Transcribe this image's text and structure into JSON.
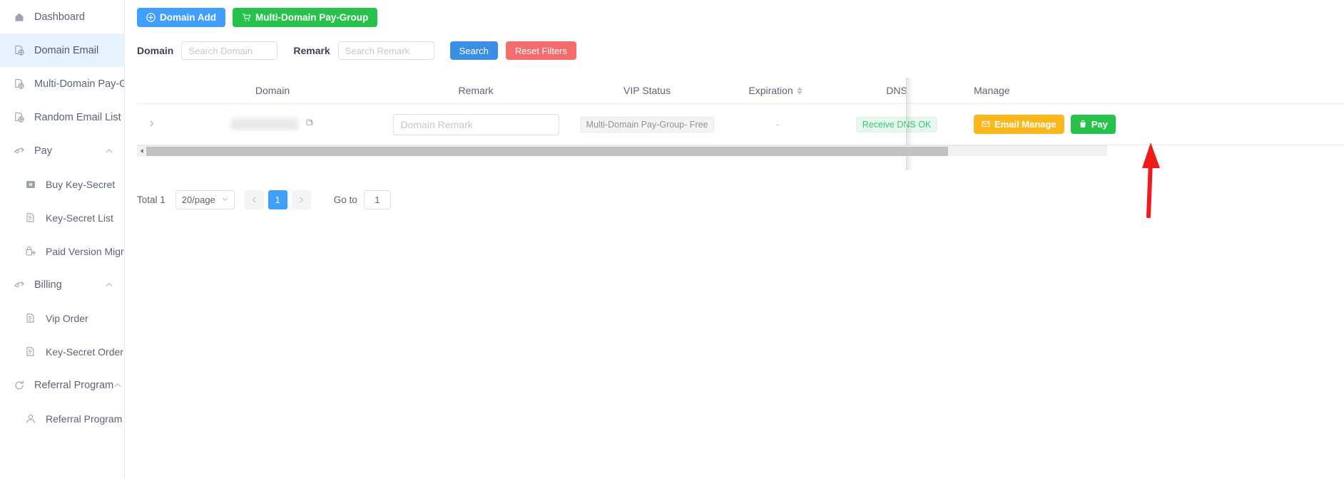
{
  "sidebar": {
    "items": [
      {
        "label": "Dashboard",
        "icon": "home-icon",
        "level": "top",
        "active": false,
        "expandable": false
      },
      {
        "label": "Domain Email",
        "icon": "globe-doc-icon",
        "level": "top",
        "active": true,
        "expandable": false
      },
      {
        "label": "Multi-Domain Pay-Group",
        "icon": "globe-doc-icon",
        "level": "top",
        "active": false,
        "expandable": false
      },
      {
        "label": "Random Email List",
        "icon": "globe-doc-icon",
        "level": "top",
        "active": false,
        "expandable": false
      },
      {
        "label": "Pay",
        "icon": "pay-icon",
        "level": "top",
        "active": false,
        "expandable": true
      },
      {
        "label": "Buy Key-Secret",
        "icon": "card-icon",
        "level": "child",
        "active": false,
        "expandable": false
      },
      {
        "label": "Key-Secret List",
        "icon": "list-doc-icon",
        "level": "child",
        "active": false,
        "expandable": false
      },
      {
        "label": "Paid Version Migration",
        "icon": "upgrade-icon",
        "level": "child",
        "active": false,
        "expandable": false
      },
      {
        "label": "Billing",
        "icon": "pay-icon",
        "level": "top",
        "active": false,
        "expandable": true
      },
      {
        "label": "Vip Order",
        "icon": "list-doc-icon",
        "level": "child",
        "active": false,
        "expandable": false
      },
      {
        "label": "Key-Secret Order",
        "icon": "list-doc-icon",
        "level": "child",
        "active": false,
        "expandable": false
      },
      {
        "label": "Referral Program",
        "icon": "refresh-icon",
        "level": "top",
        "active": false,
        "expandable": true
      },
      {
        "label": "Referral Program",
        "icon": "person-icon",
        "level": "child",
        "active": false,
        "expandable": false
      }
    ]
  },
  "toolbar": {
    "domain_add_label": "Domain Add",
    "domain_add_icon": "plus-circle-icon",
    "pay_group_label": "Multi-Domain Pay-Group",
    "pay_group_icon": "cart-icon"
  },
  "filters": {
    "domain_label": "Domain",
    "domain_placeholder": "Search Domain",
    "domain_value": "",
    "remark_label": "Remark",
    "remark_placeholder": "Search Remark",
    "remark_value": "",
    "search_label": "Search",
    "reset_label": "Reset Filters"
  },
  "table": {
    "columns": [
      {
        "label": "Domain",
        "sortable": false
      },
      {
        "label": "Remark",
        "sortable": false
      },
      {
        "label": "VIP Status",
        "sortable": false
      },
      {
        "label": "Expiration",
        "sortable": true
      },
      {
        "label": "DNS",
        "sortable": false
      },
      {
        "label": "Manage",
        "sortable": false
      }
    ],
    "rows": [
      {
        "expander_icon": "chevron-right-icon",
        "domain": "",
        "domain_redacted": true,
        "copy_icon": "copy-icon",
        "remark_placeholder": "Domain Remark",
        "remark_value": "",
        "vip_status": "Multi-Domain Pay-Group- Free",
        "expiration": "-",
        "dns": "Receive DNS OK",
        "manage": {
          "email_manage_label": "Email Manage",
          "email_manage_icon": "envelope-icon",
          "pay_label": "Pay",
          "pay_icon": "bag-icon"
        }
      }
    ]
  },
  "scrollbar": {
    "left_arrow_icon": "chevron-left-icon"
  },
  "pagination": {
    "total_label": "Total 1",
    "page_size": "20/page",
    "page_size_chevron": "chevron-down-icon",
    "prev_icon": "chevron-left-icon",
    "next_icon": "chevron-right-icon",
    "current_page": "1",
    "goto_label": "Go to",
    "goto_value": "1"
  },
  "annotation": {
    "arrow_color": "#f01c1c",
    "points_to": "pay-button"
  },
  "colors": {
    "primary_blue": "#409eff",
    "green": "#27c24c",
    "orange": "#fbb81c",
    "red": "#f56c6c",
    "active_nav_bg": "#e6f2fd"
  }
}
